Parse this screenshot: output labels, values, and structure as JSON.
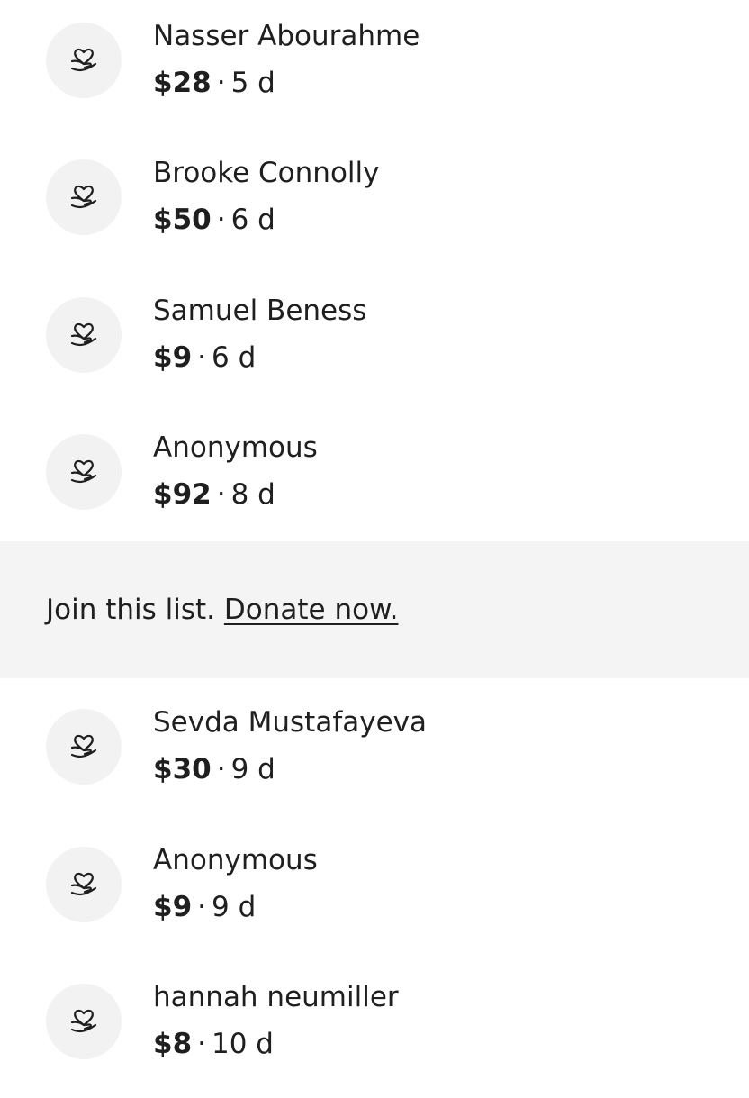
{
  "donations_before": [
    {
      "name": "Nasser Abourahme",
      "amount": "$28",
      "time": "5 d",
      "icon": "heart-in-hand-icon"
    },
    {
      "name": "Brooke Connolly",
      "amount": "$50",
      "time": "6 d",
      "icon": "heart-in-hand-icon"
    },
    {
      "name": "Samuel Beness",
      "amount": "$9",
      "time": "6 d",
      "icon": "heart-in-hand-icon"
    },
    {
      "name": "Anonymous",
      "amount": "$92",
      "time": "8 d",
      "icon": "heart-in-hand-icon"
    }
  ],
  "banner": {
    "text": "Join this list.",
    "link": "Donate now."
  },
  "donations_after": [
    {
      "name": "Sevda Mustafayeva",
      "amount": "$30",
      "time": "9 d",
      "icon": "heart-in-hand-icon"
    },
    {
      "name": "Anonymous",
      "amount": "$9",
      "time": "9 d",
      "icon": "heart-in-hand-icon"
    },
    {
      "name": "hannah neumiller",
      "amount": "$8",
      "time": "10 d",
      "icon": "heart-in-hand-icon"
    }
  ],
  "separator": "·",
  "colors": {
    "text": "#1f1f1f",
    "avatar_bg": "#f2f2f2",
    "banner_bg": "#f4f4f4"
  }
}
